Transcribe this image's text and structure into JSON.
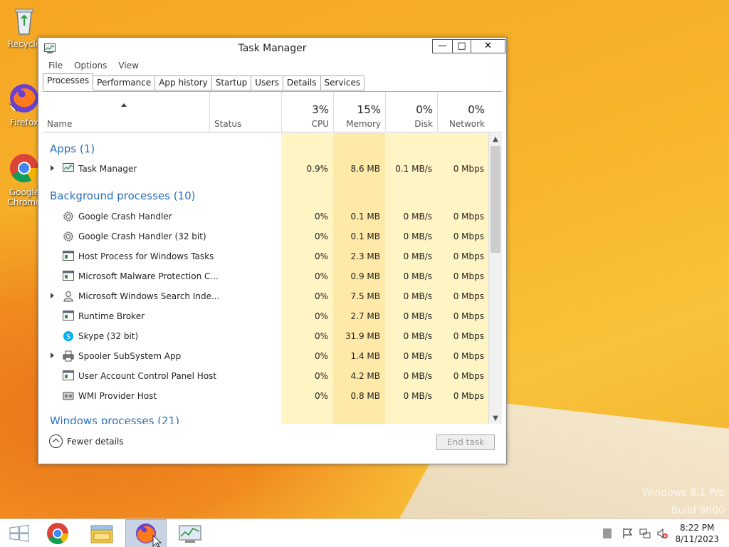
{
  "desktop": {
    "icons": [
      {
        "label": "Recycle"
      },
      {
        "label": "Firefox"
      },
      {
        "label": "Google Chrome"
      }
    ],
    "watermark": {
      "line1": "Windows 8.1 Pro",
      "line2": "Build 9600"
    }
  },
  "window": {
    "title": "Task Manager",
    "controls": {
      "minimize": "—",
      "maximize": "□",
      "close": "✕"
    },
    "menu": [
      "File",
      "Options",
      "View"
    ],
    "tabs": [
      "Processes",
      "Performance",
      "App history",
      "Startup",
      "Users",
      "Details",
      "Services"
    ],
    "active_tab": "Processes",
    "header": {
      "name": "Name",
      "status": "Status",
      "cpu": {
        "pct": "3%",
        "label": "CPU"
      },
      "memory": {
        "pct": "15%",
        "label": "Memory"
      },
      "disk": {
        "pct": "0%",
        "label": "Disk"
      },
      "network": {
        "pct": "0%",
        "label": "Network"
      }
    },
    "groups": {
      "apps": "Apps (1)",
      "background": "Background processes (10)",
      "windows": "Windows processes (21)"
    },
    "apps": [
      {
        "name": "Task Manager",
        "cpu": "0.9%",
        "memory": "8.6 MB",
        "disk": "0.1 MB/s",
        "network": "0 Mbps",
        "icon": "task-manager-icon",
        "expandable": true
      }
    ],
    "background": [
      {
        "name": "Google Crash Handler",
        "cpu": "0%",
        "memory": "0.1 MB",
        "disk": "0 MB/s",
        "network": "0 Mbps",
        "icon": "gear-icon",
        "expandable": false
      },
      {
        "name": "Google Crash Handler (32 bit)",
        "cpu": "0%",
        "memory": "0.1 MB",
        "disk": "0 MB/s",
        "network": "0 Mbps",
        "icon": "gear-icon",
        "expandable": false
      },
      {
        "name": "Host Process for Windows Tasks",
        "cpu": "0%",
        "memory": "2.3 MB",
        "disk": "0 MB/s",
        "network": "0 Mbps",
        "icon": "window-icon",
        "expandable": false
      },
      {
        "name": "Microsoft Malware Protection C...",
        "cpu": "0%",
        "memory": "0.9 MB",
        "disk": "0 MB/s",
        "network": "0 Mbps",
        "icon": "window-icon",
        "expandable": false
      },
      {
        "name": "Microsoft Windows Search Inde...",
        "cpu": "0%",
        "memory": "7.5 MB",
        "disk": "0 MB/s",
        "network": "0 Mbps",
        "icon": "search-person-icon",
        "expandable": true
      },
      {
        "name": "Runtime Broker",
        "cpu": "0%",
        "memory": "2.7 MB",
        "disk": "0 MB/s",
        "network": "0 Mbps",
        "icon": "window-icon",
        "expandable": false
      },
      {
        "name": "Skype (32 bit)",
        "cpu": "0%",
        "memory": "31.9 MB",
        "disk": "0 MB/s",
        "network": "0 Mbps",
        "icon": "skype-icon",
        "expandable": false
      },
      {
        "name": "Spooler SubSystem App",
        "cpu": "0%",
        "memory": "1.4 MB",
        "disk": "0 MB/s",
        "network": "0 Mbps",
        "icon": "printer-icon",
        "expandable": true
      },
      {
        "name": "User Account Control Panel Host",
        "cpu": "0%",
        "memory": "4.2 MB",
        "disk": "0 MB/s",
        "network": "0 Mbps",
        "icon": "window-icon",
        "expandable": false
      },
      {
        "name": "WMI Provider Host",
        "cpu": "0%",
        "memory": "0.8 MB",
        "disk": "0 MB/s",
        "network": "0 Mbps",
        "icon": "wmi-icon",
        "expandable": false
      }
    ],
    "footer": {
      "fewer_details": "Fewer details",
      "end_task": "End task"
    }
  },
  "taskbar": {
    "items": [
      "windows-start-icon",
      "chrome-icon",
      "file-explorer-icon",
      "firefox-icon",
      "task-manager-icon"
    ],
    "active_item": "firefox-icon",
    "clock": {
      "time": "8:22 PM",
      "date": "8/11/2023"
    }
  },
  "colors": {
    "group_header": "#2a6ebb",
    "cpu_highlight": "#fff4c4",
    "memory_highlight": "#ffe9a8",
    "accent_taskbar": "#c8d4e4"
  }
}
